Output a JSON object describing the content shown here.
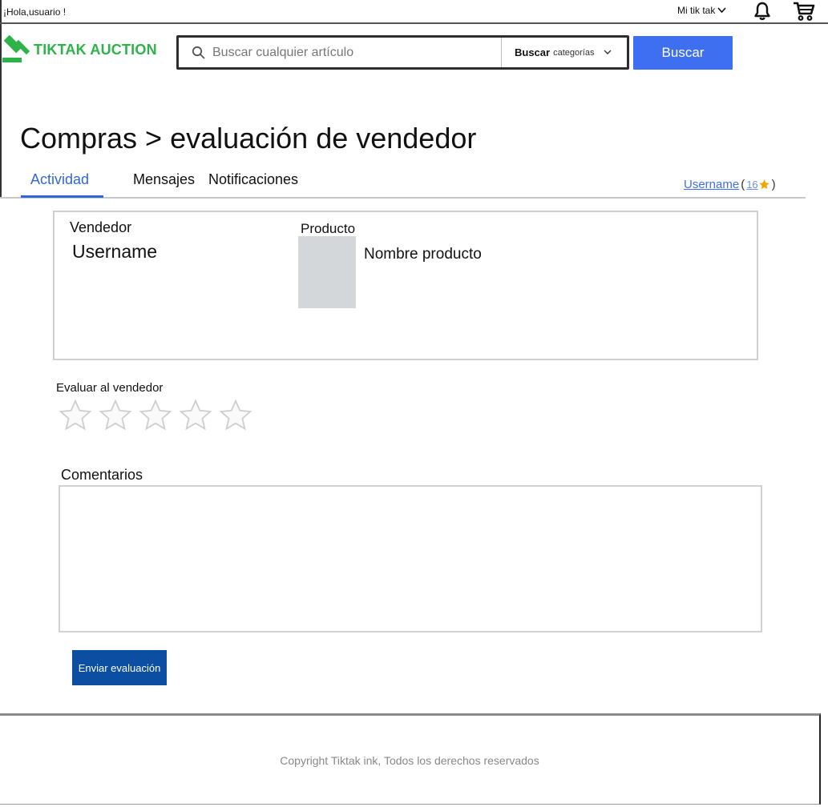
{
  "topbar": {
    "greeting": "¡Hola,usuario !",
    "my_menu_label": "Mi tik tak",
    "icons": [
      "bell-icon",
      "cart-icon",
      "chevron-down-icon"
    ]
  },
  "header": {
    "logo_text": "TIKTAK AUCTION",
    "search_placeholder": "Buscar cualquier artículo",
    "category_strong": "Buscar",
    "category_light": "categorías",
    "search_button": "Buscar"
  },
  "page": {
    "title": "Compras > evaluación de vendedor"
  },
  "tabs": {
    "items": [
      {
        "label": "Actividad",
        "active": true
      },
      {
        "label": "Mensajes",
        "active": false
      },
      {
        "label": "Notificaciones",
        "active": false
      }
    ],
    "user_link": "Username",
    "user_rating": "16",
    "open_paren": "(",
    "close_paren": ")"
  },
  "info": {
    "seller_label": "Vendedor",
    "seller_name": "Username",
    "product_label": "Producto",
    "product_name": "Nombre producto"
  },
  "rating": {
    "label": "Evaluar al vendedor",
    "max_stars": 5,
    "selected": 0
  },
  "comments": {
    "label": "Comentarios",
    "value": ""
  },
  "submit": {
    "label": "Enviar evaluación"
  },
  "footer": {
    "copyright": "Copyright Tiktak ink, Todos los derechos reservados"
  },
  "colors": {
    "brand_green": "#2db34a",
    "primary_blue": "#3e6ff0",
    "submit_blue": "#0b4ea2",
    "active_tab": "#3267d6",
    "star_gold": "#f0a500"
  }
}
